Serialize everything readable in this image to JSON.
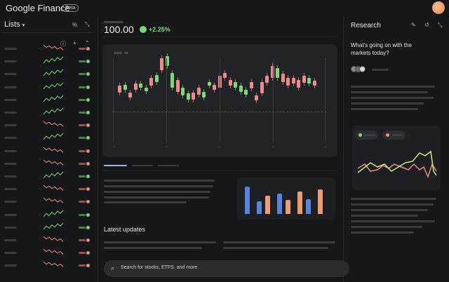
{
  "header": {
    "logo_text": "Google Finance",
    "badge": "Beta"
  },
  "sidebar": {
    "title": "Lists",
    "percent_label": "%",
    "rows": 18
  },
  "quote": {
    "price": "100.00",
    "change": "+2.25%"
  },
  "chart_candles": [
    [
      0,
      0.62,
      0.55
    ],
    [
      1,
      0.58,
      0.63
    ],
    [
      2,
      0.55,
      0.5
    ],
    [
      3,
      0.64,
      0.58
    ],
    [
      4,
      0.6,
      0.64
    ],
    [
      5,
      0.58,
      0.6
    ],
    [
      6,
      0.7,
      0.62
    ],
    [
      7,
      0.66,
      0.73
    ],
    [
      8,
      0.9,
      0.78
    ],
    [
      9,
      0.82,
      0.92
    ],
    [
      10,
      0.6,
      0.75
    ],
    [
      11,
      0.68,
      0.56
    ],
    [
      12,
      0.52,
      0.6
    ],
    [
      13,
      0.48,
      0.54
    ],
    [
      14,
      0.55,
      0.48
    ],
    [
      15,
      0.6,
      0.53
    ],
    [
      16,
      0.5,
      0.56
    ],
    [
      17,
      0.62,
      0.66
    ],
    [
      18,
      0.63,
      0.58
    ],
    [
      19,
      0.72,
      0.6
    ],
    [
      20,
      0.75,
      0.7
    ],
    [
      21,
      0.68,
      0.62
    ],
    [
      22,
      0.6,
      0.66
    ],
    [
      23,
      0.56,
      0.62
    ],
    [
      24,
      0.53,
      0.58
    ],
    [
      25,
      0.66,
      0.59
    ],
    [
      26,
      0.52,
      0.47
    ],
    [
      27,
      0.66,
      0.54
    ],
    [
      28,
      0.72,
      0.65
    ],
    [
      29,
      0.82,
      0.7
    ],
    [
      30,
      0.7,
      0.8
    ],
    [
      31,
      0.74,
      0.66
    ],
    [
      32,
      0.7,
      0.62
    ],
    [
      33,
      0.7,
      0.64
    ],
    [
      34,
      0.68,
      0.6
    ],
    [
      35,
      0.72,
      0.65
    ],
    [
      36,
      0.64,
      0.7
    ],
    [
      37,
      0.67,
      0.62
    ]
  ],
  "bars": [
    [
      0.75,
      "blue"
    ],
    [
      0.35,
      "blue"
    ],
    [
      0.5,
      "orange"
    ],
    [
      0.55,
      "blue"
    ],
    [
      0.38,
      "orange"
    ],
    [
      0.62,
      "orange"
    ],
    [
      0.4,
      "blue"
    ],
    [
      0.68,
      "orange"
    ]
  ],
  "latest_updates": {
    "title": "Latest updates"
  },
  "research": {
    "title": "Research",
    "prompt": "What's going on with the markets today?"
  },
  "search": {
    "placeholder": "Search for stocks, ETFS, and more"
  },
  "colors": {
    "green": "#7ed67a",
    "red": "#ef8b86",
    "blue": "#5b84e0",
    "orange": "#f09a74"
  }
}
